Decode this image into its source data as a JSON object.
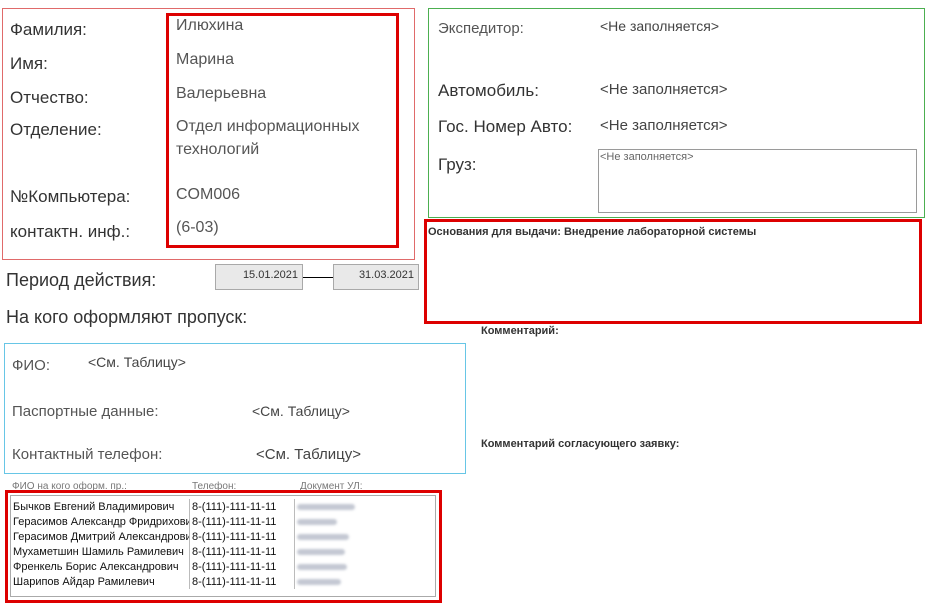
{
  "employee": {
    "surname_label": "Фамилия:",
    "surname": "Илюхина",
    "name_label": "Имя:",
    "name": "Марина",
    "patronymic_label": "Отчество:",
    "patronymic": "Валерьевна",
    "department_label": "Отделение:",
    "department_line1": "Отдел информационных",
    "department_line2": "технологий",
    "computer_label": "№Компьютера:",
    "computer": "COM006",
    "contact_label": "контактн. инф.:",
    "contact": "(6-03)"
  },
  "transport": {
    "forwarder_label": "Экспедитор:",
    "forwarder": "<Не заполняется>",
    "car_label": "Автомобиль:",
    "car": "<Не заполняется>",
    "plate_label": "Гос. Номер Авто:",
    "plate": "<Не заполняется>",
    "cargo_label": "Груз:",
    "cargo": "<Не заполняется>"
  },
  "grounds_text": "Основания для выдачи: Внедрение лабораторной системы",
  "period": {
    "label": "Период действия:",
    "from": "15.01.2021",
    "to": "31.03.2021"
  },
  "pass_for_label": "На кого оформляют пропуск:",
  "visitor": {
    "fio_label": "ФИО:",
    "fio": "<См. Таблицу>",
    "passport_label": "Паспортные данные:",
    "passport": "<См. Таблицу>",
    "phone_label": "Контактный телефон:",
    "phone": "<См. Таблицу>"
  },
  "comment_label": "Комментарий:",
  "approver_comment_label": "Комментарий согласующего заявку:",
  "table": {
    "headers": [
      "ФИО на кого оформ. пр.:",
      "Телефон:",
      "Документ УЛ:"
    ],
    "rows": [
      {
        "name": "Бычков Евгений Владимирович",
        "phone": "8-(111)-111-11-11"
      },
      {
        "name": "Герасимов Александр Фридрихович",
        "phone": "8-(111)-111-11-11"
      },
      {
        "name": "Герасимов Дмитрий Александрович",
        "phone": "8-(111)-111-11-11"
      },
      {
        "name": "Мухаметшин Шамиль Рамилевич",
        "phone": "8-(111)-111-11-11"
      },
      {
        "name": "Френкель Борис Александрович",
        "phone": "8-(111)-111-11-11"
      },
      {
        "name": "Шарипов Айдар Рамилевич",
        "phone": "8-(111)-111-11-11"
      }
    ]
  },
  "colors": {
    "highlight_red": "#dd0000",
    "employee_border": "#e06a6a",
    "transport_border": "#4caf50",
    "visitor_border": "#67c6e6"
  }
}
